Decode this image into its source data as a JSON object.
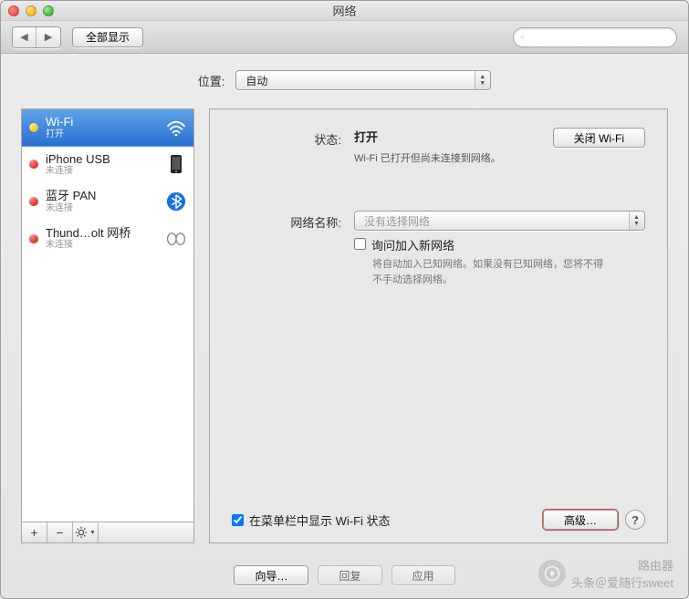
{
  "window": {
    "title": "网络"
  },
  "toolbar": {
    "show_all": "全部显示"
  },
  "location": {
    "label": "位置:",
    "value": "自动"
  },
  "sidebar": {
    "items": [
      {
        "name": "Wi-Fi",
        "status": "打开",
        "dot": "yellow",
        "icon": "wifi",
        "selected": true
      },
      {
        "name": "iPhone USB",
        "status": "未连接",
        "dot": "red",
        "icon": "iphone",
        "selected": false
      },
      {
        "name": "蓝牙 PAN",
        "status": "未连接",
        "dot": "red",
        "icon": "bluetooth",
        "selected": false
      },
      {
        "name": "Thund…olt 网桥",
        "status": "未连接",
        "dot": "red",
        "icon": "thunderbolt",
        "selected": false
      }
    ]
  },
  "detail": {
    "status_label": "状态:",
    "status_value": "打开",
    "turn_off_btn": "关闭 Wi-Fi",
    "status_desc": "Wi-Fi 已打开但尚未连接到网络。",
    "network_name_label": "网络名称:",
    "network_name_placeholder": "没有选择网络",
    "ask_join_label": "询问加入新网络",
    "ask_join_hint": "将自动加入已知网络。如果没有已知网络，您将不得不手动选择网络。",
    "show_in_menu_label": "在菜单栏中显示 Wi-Fi 状态",
    "advanced_btn": "高级…",
    "help_btn": "?"
  },
  "footer": {
    "wizard": "向导…",
    "revert": "回复",
    "apply": "应用"
  },
  "watermark": {
    "line1": "路由器",
    "line2": "头条＠爱随行sweet"
  }
}
